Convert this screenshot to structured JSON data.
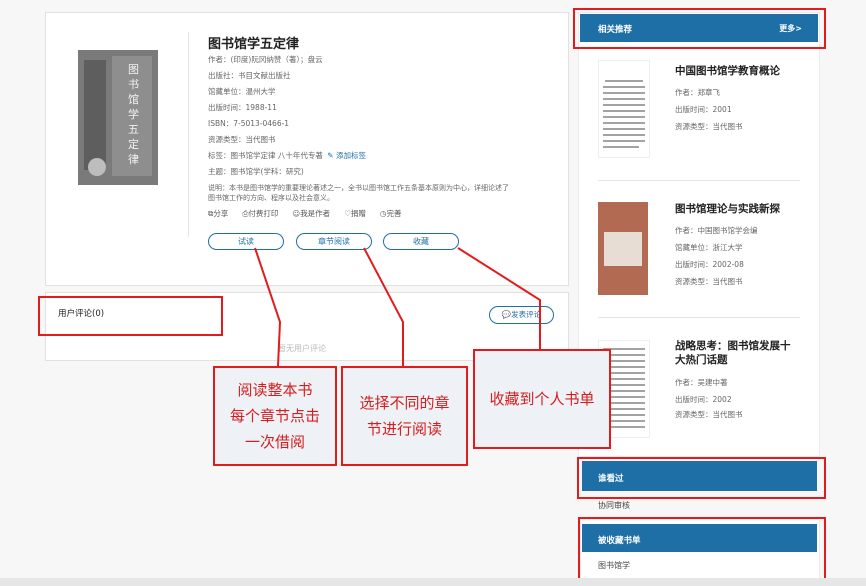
{
  "book": {
    "title": "图书馆学五定律",
    "author": "作者：(印度)阮冈纳赞（著）；盘云",
    "publisher": "出版社：书目文献出版社",
    "organization": "馆藏单位：温州大学",
    "publish_date": "出版时间：1988-11",
    "isbn": "ISBN：7-5013-0466-1",
    "resource_type": "资源类型：当代图书",
    "tags": "标签：图书馆学定律 八十年代专著",
    "add_tag": "添加标签",
    "subject": "主题：图书馆学(学科：研究)",
    "description_line1": "说明：本书是图书馆学的重要理论著述之一，全书以图书馆工作五条基本原则为中心，详细论述了",
    "description_line2": "图书馆工作的方向、程序以及社会意义。",
    "cover_text": "图书馆学五定律"
  },
  "actions": {
    "share": "分享",
    "print": "付费打印",
    "author": "我是作者",
    "favorite": "捐赠",
    "complete": "完善"
  },
  "buttons": {
    "trial_read": "试读",
    "chapter_read": "章节阅读",
    "collect": "收藏"
  },
  "comments": {
    "title": "用户评论(0)",
    "post_button": "发表评论",
    "empty": "暂无用户评论"
  },
  "callouts": {
    "read_whole": "阅读整本书\n每个章节点击\n一次借阅",
    "chapter": "选择不同的章\n节进行阅读",
    "collect": "收藏到个人书单"
  },
  "sidebar": {
    "related_title": "相关推荐",
    "more": "更多>",
    "items": [
      {
        "title": "中国图书馆学教育概论",
        "author": "作者：郑章飞",
        "date": "出版时间：2001",
        "type": "资源类型：当代图书"
      },
      {
        "title": "图书馆理论与实践新探",
        "author": "作者：中国图书馆学会编",
        "org": "馆藏单位：浙江大学",
        "date": "出版时间：2002-08",
        "type": "资源类型：当代图书"
      },
      {
        "title": "战略思考：图书馆发展十",
        "title2": "大热门话题",
        "author": "作者：吴建中著",
        "date": "出版时间：2002",
        "type": "资源类型：当代图书"
      }
    ],
    "viewed_title": "谁看过",
    "viewed_item": "协同审核",
    "collected_title": "被收藏书单",
    "collected_item": "图书馆学"
  },
  "colors": {
    "accent": "#1f6fa7",
    "highlight": "#e21c1c"
  }
}
